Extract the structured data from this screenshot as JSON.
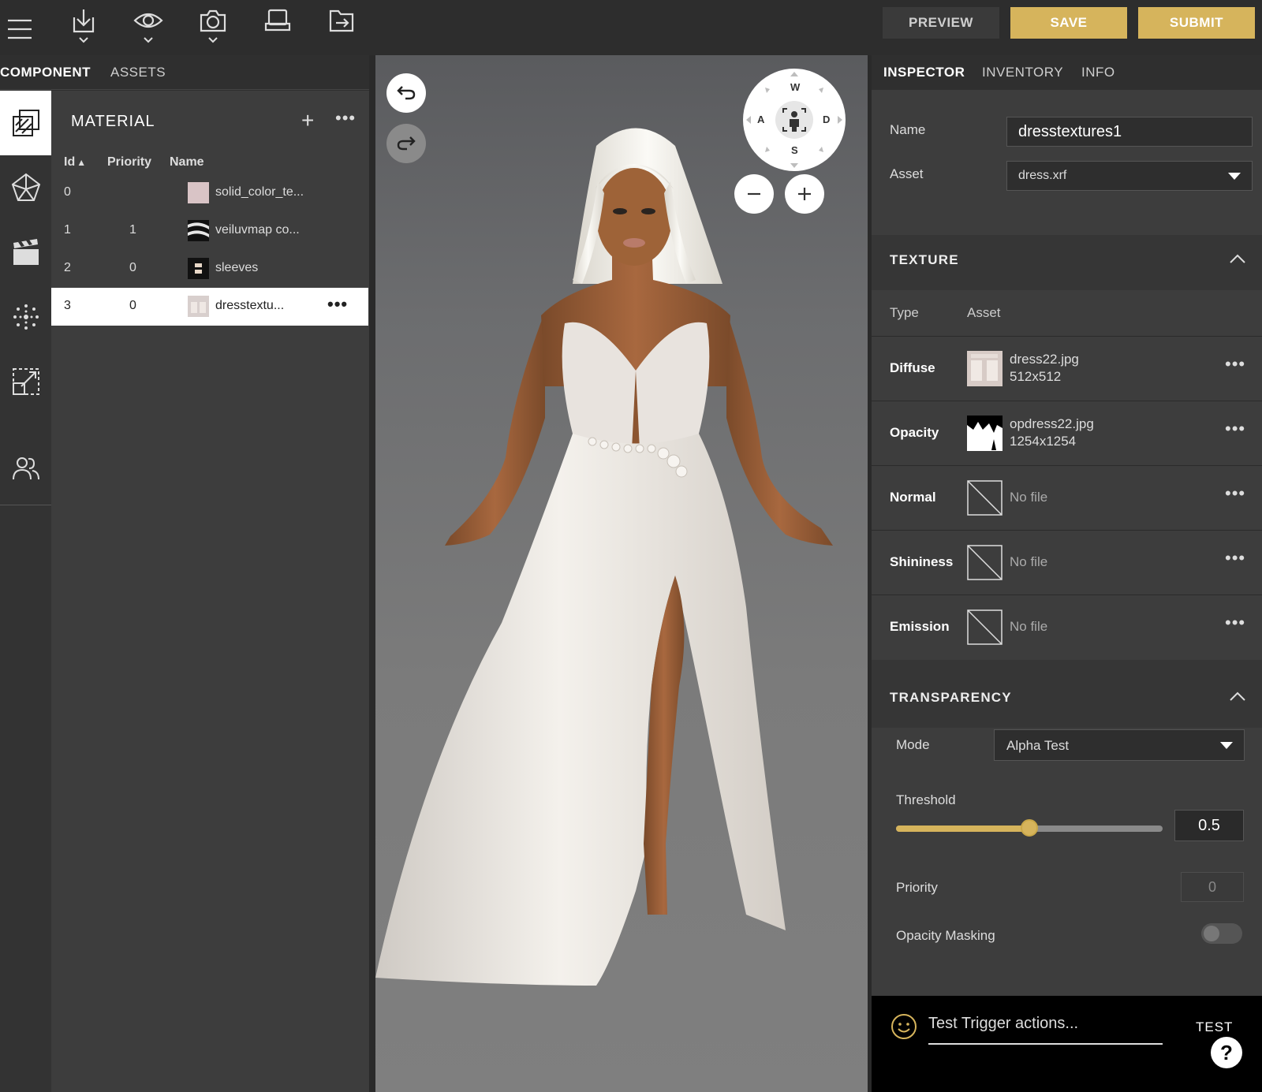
{
  "toolbar": {
    "icons": [
      "menu-icon",
      "import-icon",
      "eye-icon",
      "camera-icon",
      "scanner-icon",
      "export-icon"
    ],
    "preview_label": "PREVIEW",
    "save_label": "SAVE",
    "submit_label": "SUBMIT",
    "accent_color": "#d6b45c"
  },
  "left_tabs": {
    "component": "COMPONENT",
    "assets": "ASSETS"
  },
  "rail": {
    "items": [
      "material-icon",
      "mesh-icon",
      "animation-icon",
      "particles-icon",
      "scale-icon",
      "people-icon"
    ],
    "active": "material-icon"
  },
  "materials": {
    "title": "MATERIAL",
    "columns": {
      "id": "Id",
      "priority": "Priority",
      "name": "Name"
    },
    "rows": [
      {
        "id": "0",
        "priority": "",
        "name": "solid_color_te...",
        "thumb_color": "#d9c4c6"
      },
      {
        "id": "1",
        "priority": "1",
        "name": "veiluvmap co...",
        "thumb_color": "#dddddd"
      },
      {
        "id": "2",
        "priority": "0",
        "name": "sleeves",
        "thumb_color": "#111111"
      },
      {
        "id": "3",
        "priority": "0",
        "name": "dresstextu...",
        "thumb_color": "#d8cfcd"
      }
    ],
    "selected_index": 3
  },
  "viewport": {
    "compass": {
      "north": "W",
      "west": "A",
      "east": "D",
      "south": "S"
    },
    "buttons": [
      "undo-icon",
      "redo-icon",
      "zoom-out-icon",
      "zoom-in-icon"
    ]
  },
  "inspector": {
    "tabs": {
      "inspector": "INSPECTOR",
      "inventory": "INVENTORY",
      "info": "INFO"
    },
    "name_label": "Name",
    "name_value": "dresstextures1",
    "asset_label": "Asset",
    "asset_value": "dress.xrf",
    "texture": {
      "title": "TEXTURE",
      "type_col": "Type",
      "asset_col": "Asset",
      "rows": [
        {
          "type": "Diffuse",
          "file": "dress22.jpg",
          "size": "512x512",
          "thumb": "dress"
        },
        {
          "type": "Opacity",
          "file": "opdress22.jpg",
          "size": "1254x1254",
          "thumb": "opacity"
        },
        {
          "type": "Normal",
          "file": "No file",
          "size": "",
          "thumb": "empty"
        },
        {
          "type": "Shininess",
          "file": "No file",
          "size": "",
          "thumb": "empty"
        },
        {
          "type": "Emission",
          "file": "No file",
          "size": "",
          "thumb": "empty"
        }
      ]
    },
    "transparency": {
      "title": "TRANSPARENCY",
      "mode_label": "Mode",
      "mode_value": "Alpha Test",
      "threshold_label": "Threshold",
      "threshold_value": "0.5",
      "threshold_fraction": 0.5,
      "priority_label": "Priority",
      "priority_value": "0",
      "opacity_masking_label": "Opacity Masking",
      "opacity_masking_on": false
    }
  },
  "trigger": {
    "placeholder": "Test Trigger actions...",
    "test_label": "TEST",
    "help_label": "?"
  }
}
